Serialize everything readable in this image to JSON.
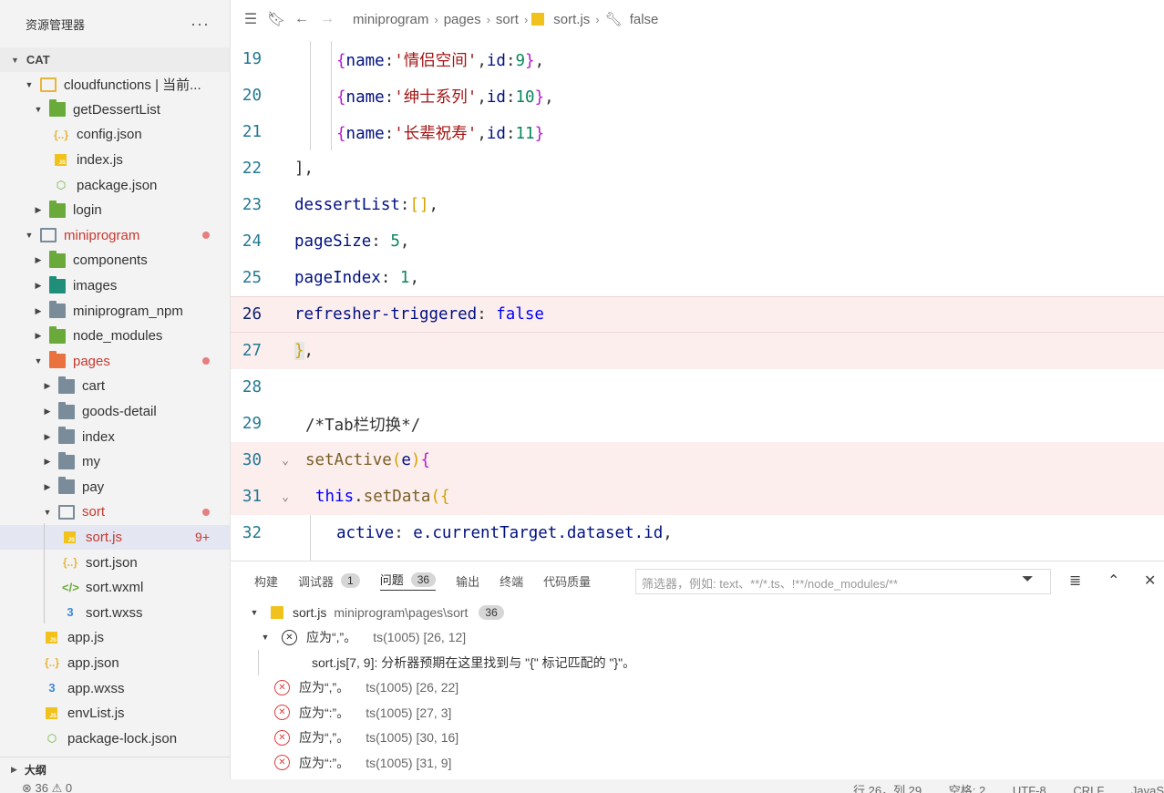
{
  "sidebar": {
    "title": "资源管理器",
    "more_label": "···",
    "section": "CAT",
    "outline_label": "大纲",
    "items": [
      {
        "label": "cloudfunctions | 当前..."
      },
      {
        "label": "getDessertList"
      },
      {
        "label": "config.json"
      },
      {
        "label": "index.js"
      },
      {
        "label": "package.json"
      },
      {
        "label": "login"
      },
      {
        "label": "miniprogram"
      },
      {
        "label": "components"
      },
      {
        "label": "images"
      },
      {
        "label": "miniprogram_npm"
      },
      {
        "label": "node_modules"
      },
      {
        "label": "pages"
      },
      {
        "label": "cart"
      },
      {
        "label": "goods-detail"
      },
      {
        "label": "index"
      },
      {
        "label": "my"
      },
      {
        "label": "pay"
      },
      {
        "label": "sort"
      },
      {
        "label": "sort.js",
        "badge": "9+"
      },
      {
        "label": "sort.json"
      },
      {
        "label": "sort.wxml"
      },
      {
        "label": "sort.wxss"
      },
      {
        "label": "app.js"
      },
      {
        "label": "app.json"
      },
      {
        "label": "app.wxss"
      },
      {
        "label": "envList.js"
      },
      {
        "label": "package-lock.json"
      }
    ]
  },
  "breadcrumb": {
    "items": [
      "miniprogram",
      "pages",
      "sort",
      "sort.js",
      "false"
    ]
  },
  "editor": {
    "line_numbers": [
      "19",
      "20",
      "21",
      "22",
      "23",
      "24",
      "25",
      "26",
      "27",
      "28",
      "29",
      "30",
      "31",
      "32"
    ],
    "lines": [
      {
        "name": "line-19",
        "parts": [
          "{",
          "name",
          ":",
          "'情侣空间'",
          ",",
          "id",
          ":",
          "9",
          "}",
          ","
        ]
      },
      {
        "name": "line-20",
        "parts": [
          "{",
          "name",
          ":",
          "'绅士系列'",
          ",",
          "id",
          ":",
          "10",
          "}",
          ","
        ]
      },
      {
        "name": "line-21",
        "parts": [
          "{",
          "name",
          ":",
          "'长辈祝寿'",
          ",",
          "id",
          ":",
          "11",
          "}"
        ]
      },
      {
        "name": "line-22",
        "text": "],"
      },
      {
        "name": "line-23",
        "parts": [
          "dessertList",
          ":",
          "[]",
          ","
        ]
      },
      {
        "name": "line-24",
        "parts": [
          "pageSize",
          ": ",
          "5",
          ","
        ]
      },
      {
        "name": "line-25",
        "parts": [
          "pageIndex",
          ": ",
          "1",
          ","
        ]
      },
      {
        "name": "line-26",
        "parts": [
          "refresher-triggered",
          ": ",
          "false"
        ]
      },
      {
        "name": "line-27",
        "parts": [
          "}",
          ","
        ]
      },
      {
        "name": "line-28",
        "text": ""
      },
      {
        "name": "line-29",
        "text": "/*Tab栏切换*/"
      },
      {
        "name": "line-30",
        "parts": [
          "setActive",
          "(",
          "e",
          ")",
          "{"
        ]
      },
      {
        "name": "line-31",
        "parts": [
          "this",
          ".",
          "setData",
          "({"
        ]
      },
      {
        "name": "line-32",
        "parts": [
          "active",
          ": ",
          "e.currentTarget.dataset.id",
          ","
        ]
      }
    ]
  },
  "panel": {
    "tabs": [
      {
        "label": "构建"
      },
      {
        "label": "调试器",
        "count": "1"
      },
      {
        "label": "问题",
        "count": "36"
      },
      {
        "label": "输出"
      },
      {
        "label": "终端"
      },
      {
        "label": "代码质量"
      }
    ],
    "filter_placeholder": "筛选器，例如: text、**/*.ts、!**/node_modules/**",
    "file_row": {
      "file": "sort.js",
      "path": "miniprogram\\pages\\sort",
      "count": "36"
    },
    "problems": [
      {
        "msg": "应为“,”。",
        "meta": "ts(1005)  [26, 12]"
      },
      {
        "msg": "sort.js[7, 9]: 分析器预期在这里找到与 \"{\" 标记匹配的 \"}\"。"
      },
      {
        "msg": "应为“,”。",
        "meta": "ts(1005)  [26, 22]"
      },
      {
        "msg": "应为“:”。",
        "meta": "ts(1005)  [27, 3]"
      },
      {
        "msg": "应为“,”。",
        "meta": "ts(1005)  [30, 16]"
      },
      {
        "msg": "应为“:”。",
        "meta": "ts(1005)  [31, 9]"
      }
    ]
  },
  "status": {
    "left": "⊗ 36 ⚠ 0",
    "items": [
      "行 26，列 29",
      "空格: 2",
      "UTF-8",
      "CRLF",
      "JavaScript"
    ]
  },
  "colors": {
    "error": "#e03e3e",
    "badge_red": "#c6392f",
    "line_number": "#237893"
  }
}
